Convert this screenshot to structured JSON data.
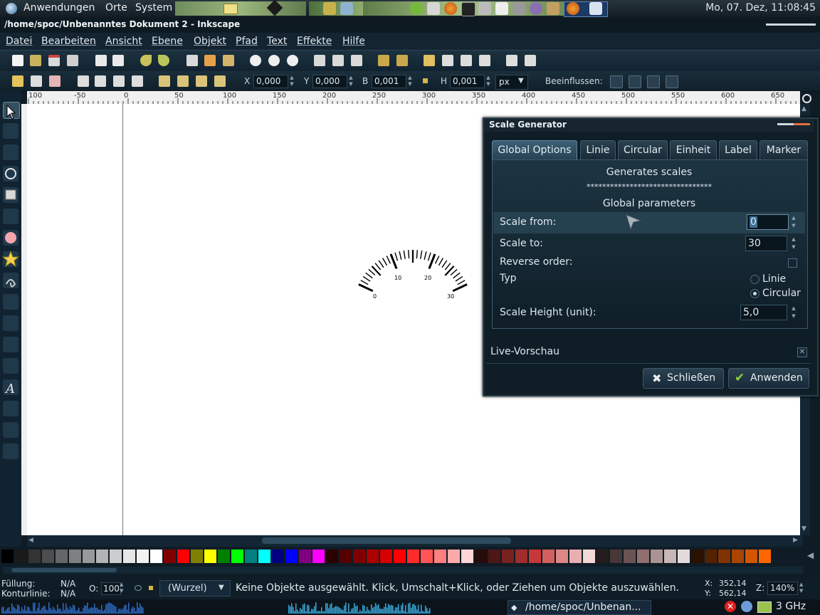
{
  "top_panel": {
    "menu": [
      "Anwendungen",
      "Orte",
      "System"
    ],
    "clock": "Mo, 07. Dez, 11:08:45"
  },
  "window": {
    "title": "/home/spoc/Unbenanntes Dokument 2 - Inkscape"
  },
  "menubar": [
    "Datei",
    "Bearbeiten",
    "Ansicht",
    "Ebene",
    "Objekt",
    "Pfad",
    "Text",
    "Effekte",
    "Hilfe"
  ],
  "tool_controls": {
    "x_label": "X",
    "x_value": "0,000",
    "y_label": "Y",
    "y_value": "0,000",
    "b_label": "B",
    "b_value": "0,001",
    "h_label": "H",
    "h_value": "0,001",
    "unit": "px",
    "affect_label": "Beeinflussen:"
  },
  "ruler": {
    "labels": [
      "100",
      "-50",
      "0",
      "50",
      "100",
      "150",
      "200",
      "250",
      "300",
      "350",
      "400",
      "450",
      "500",
      "550",
      "600",
      "650"
    ]
  },
  "drawing": {
    "scale_labels": [
      "0",
      "10",
      "20",
      "30"
    ]
  },
  "dialog": {
    "title": "Scale Generator",
    "tabs": [
      "Global Options",
      "Linie",
      "Circular",
      "Einheit",
      "Label",
      "Marker"
    ],
    "active_tab": "Global Options",
    "heading": "Generates scales",
    "stars": "********************************",
    "subheading": "Global parameters",
    "scale_from_label": "Scale from:",
    "scale_from_value": "0",
    "scale_to_label": "Scale to:",
    "scale_to_value": "30",
    "reverse_label": "Reverse order:",
    "typ_label": "Typ",
    "radio_linie": "Linie",
    "radio_circular": "Circular",
    "typ_selected": "Circular",
    "scale_height_label": "Scale Height (unit):",
    "scale_height_value": "5,0",
    "live_preview_label": "Live-Vorschau",
    "close_button": "Schließen",
    "apply_button": "Anwenden"
  },
  "status": {
    "fill_label": "Füllung:",
    "fill_value": "N/A",
    "stroke_label": "Konturlinie:",
    "stroke_value": "N/A",
    "opacity_label": "O:",
    "opacity_value": "100",
    "layer": "(Wurzel)",
    "message": "Keine Objekte ausgewählt. Klick, Umschalt+Klick, oder Ziehen um Objekte auszuwählen.",
    "cursor_x_label": "X:",
    "cursor_x": "352,14",
    "cursor_y_label": "Y:",
    "cursor_y": "562,14",
    "zoom_label": "Z:",
    "zoom": "140%"
  },
  "taskbar": {
    "task_label": "/home/spoc/Unbenan...",
    "cpu": "3 GHz"
  },
  "palette": [
    "#000000",
    "#1a1a1a",
    "#333333",
    "#4d4d4d",
    "#666666",
    "#808080",
    "#999999",
    "#b3b3b3",
    "#cccccc",
    "#e6e6e6",
    "#f2f2f2",
    "#ffffff",
    "#800000",
    "#ff0000",
    "#808000",
    "#ffff00",
    "#008000",
    "#00ff00",
    "#008080",
    "#00ffff",
    "#000080",
    "#0000ff",
    "#800080",
    "#ff00ff",
    "#2b0000",
    "#550000",
    "#800000",
    "#aa0000",
    "#d40000",
    "#ff0000",
    "#ff2a2a",
    "#ff5555",
    "#ff8080",
    "#ffaaaa",
    "#ffd5d5",
    "#280b0b",
    "#501616",
    "#782121",
    "#a02c2c",
    "#c83737",
    "#d35f5f",
    "#de8787",
    "#e9afaf",
    "#f4d7d7",
    "#241c1c",
    "#483737",
    "#6c5353",
    "#916f6f",
    "#ac9393",
    "#c8b7b7",
    "#e3dbdb",
    "#2b1100",
    "#552200",
    "#803300",
    "#aa4400",
    "#d45500",
    "#ff6600"
  ]
}
